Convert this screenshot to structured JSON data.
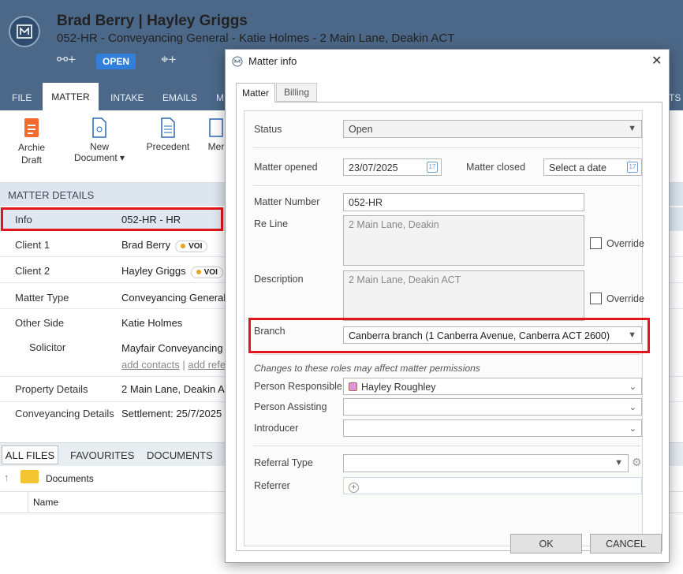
{
  "header": {
    "title": "Brad Berry | Hayley Griggs",
    "subtitle": "052-HR - Conveyancing General - Katie Holmes - 2 Main Lane, Deakin ACT",
    "status_badge": "OPEN",
    "link_icons": "⚯+",
    "tag_icons": "⌂+"
  },
  "tabs": [
    "FILE",
    "MATTER",
    "INTAKE",
    "EMAILS",
    "M",
    "TS"
  ],
  "ribbon": {
    "archie": "Archie\nDraft",
    "new_document": "New\nDocument ▾",
    "precedent": "Precedent",
    "menu": "Mer"
  },
  "matter_details": {
    "heading": "MATTER DETAILS",
    "rows": [
      {
        "label": "Info",
        "value": "052-HR - HR"
      },
      {
        "label": "Client 1",
        "value": "Brad Berry",
        "badge": "VOI"
      },
      {
        "label": "Client 2",
        "value": "Hayley Griggs",
        "badge": "VOI"
      },
      {
        "label": "Matter Type",
        "value": "Conveyancing General"
      },
      {
        "label": "Other Side",
        "value": "Katie Holmes"
      },
      {
        "label": "Solicitor",
        "value": "Mayfair Conveyancing",
        "links": [
          "add contacts",
          "|",
          "add refe"
        ]
      },
      {
        "label": "Property Details",
        "value": "2 Main Lane, Deakin AC"
      },
      {
        "label": "Conveyancing Details",
        "value": "Settlement: 25/7/2025"
      }
    ]
  },
  "files": {
    "tabs": [
      "ALL FILES",
      "FAVOURITES",
      "DOCUMENTS"
    ],
    "folder": "Documents",
    "column": "Name"
  },
  "dialog": {
    "title": "Matter info",
    "tabs": [
      "Matter",
      "Billing"
    ],
    "status": {
      "label": "Status",
      "value": "Open"
    },
    "opened": {
      "label": "Matter opened",
      "value": "23/07/2025"
    },
    "closed": {
      "label": "Matter closed",
      "placeholder": "Select a date"
    },
    "number": {
      "label": "Matter Number",
      "value": "052-HR"
    },
    "reline": {
      "label": "Re Line",
      "value": "2 Main Lane, Deakin",
      "override": "Override"
    },
    "description": {
      "label": "Description",
      "value": "2 Main Lane, Deakin ACT",
      "override": "Override"
    },
    "branch": {
      "label": "Branch",
      "value": "Canberra branch  (1 Canberra Avenue, Canberra ACT 2600)"
    },
    "roles_note": "Changes to these roles may affect matter permissions",
    "person_responsible": {
      "label": "Person Responsible",
      "value": "Hayley Roughley"
    },
    "person_assisting": {
      "label": "Person Assisting",
      "value": ""
    },
    "introducer": {
      "label": "Introducer",
      "value": ""
    },
    "referral_type": {
      "label": "Referral Type",
      "value": ""
    },
    "referrer": {
      "label": "Referrer",
      "value": ""
    },
    "ok": "OK",
    "cancel": "CANCEL"
  },
  "colors": {
    "header": "#4c6888",
    "highlight": "#e3161e",
    "accent": "#2f7fdb"
  }
}
